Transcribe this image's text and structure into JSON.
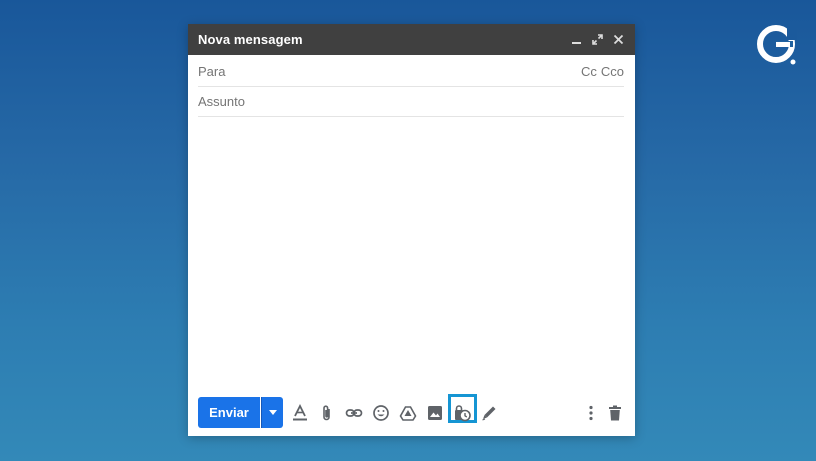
{
  "compose": {
    "title": "Nova mensagem",
    "to_label": "Para",
    "cc_label": "Cc",
    "bcc_label": "Cco",
    "subject_label": "Assunto",
    "send_label": "Enviar"
  },
  "toolbar_icons": [
    "formatting-icon",
    "attach-icon",
    "link-icon",
    "emoji-icon",
    "drive-icon",
    "photo-icon",
    "confidential-mode-icon",
    "signature-icon",
    "more-options-icon",
    "delete-icon"
  ],
  "highlighted_tool": "confidential-mode-icon",
  "colors": {
    "title_bar": "#404040",
    "send_button": "#1a73e8",
    "highlight": "#1595d3",
    "icon": "#5f6368"
  }
}
